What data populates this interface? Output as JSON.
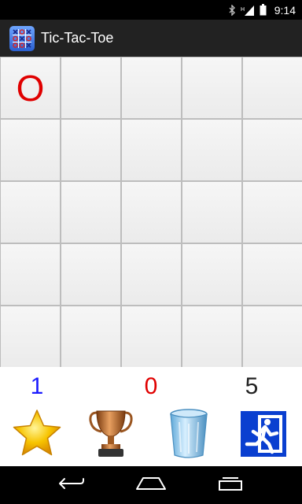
{
  "status_bar": {
    "time": "9:14",
    "icons": [
      "bluetooth-icon",
      "signal-icon",
      "battery-icon"
    ]
  },
  "app": {
    "title": "Tic-Tac-Toe",
    "icon": "tic-tac-toe-app-icon"
  },
  "board": {
    "rows": 5,
    "cols": 5,
    "cells": [
      [
        "O",
        "",
        "",
        "",
        ""
      ],
      [
        "",
        "",
        "",
        "",
        ""
      ],
      [
        "",
        "",
        "",
        "",
        ""
      ],
      [
        "",
        "",
        "",
        "",
        ""
      ],
      [
        "",
        "",
        "",
        "",
        ""
      ]
    ]
  },
  "scores": {
    "player_one": "1",
    "player_two": "0",
    "draws": "5",
    "colors": {
      "player_one": "#1a1aff",
      "player_two": "#e00000",
      "draws": "#222222"
    }
  },
  "toolbar": {
    "items": [
      {
        "icon": "star-icon"
      },
      {
        "icon": "trophy-icon"
      },
      {
        "icon": "trash-bin-icon"
      },
      {
        "icon": "exit-icon"
      }
    ]
  },
  "nav": {
    "items": [
      "back-icon",
      "home-icon",
      "recent-apps-icon"
    ]
  }
}
